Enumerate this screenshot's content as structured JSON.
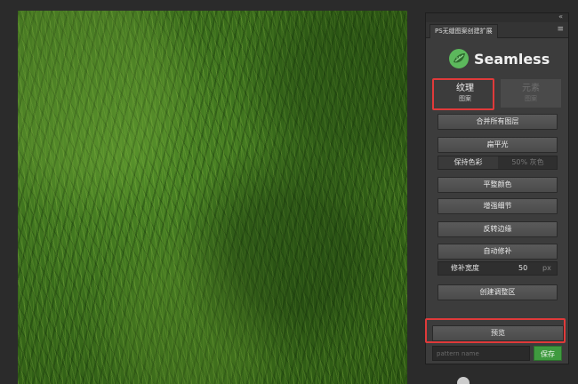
{
  "panel": {
    "tab_title": "PS无缝图案创建扩展",
    "collapse_icon": "«",
    "menu_icon": "≡",
    "logo_text": "Seamless"
  },
  "tabs": [
    {
      "main": "纹理",
      "sub": "图案"
    },
    {
      "main": "元素",
      "sub": "图案"
    }
  ],
  "buttons": {
    "merge_layers": "合并所有图层",
    "flatten_light": "扁平光",
    "keep_color": "保持色彩",
    "gray_50": "50% 灰色",
    "even_color": "平整颜色",
    "enhance_detail": "增强细节",
    "flip_edges": "反转边缘",
    "auto_patch": "自动修补",
    "patch_width_label": "修补宽度",
    "patch_width_value": "50",
    "patch_width_unit": "px",
    "create_adjust": "创建调整区",
    "preview": "预览",
    "save": "保存"
  },
  "pattern_name": {
    "placeholder": "pattern name",
    "value": ""
  },
  "colors": {
    "accent_green": "#3f9a3f",
    "highlight_red": "#e03a3a",
    "panel_bg": "#3c3c3c"
  }
}
